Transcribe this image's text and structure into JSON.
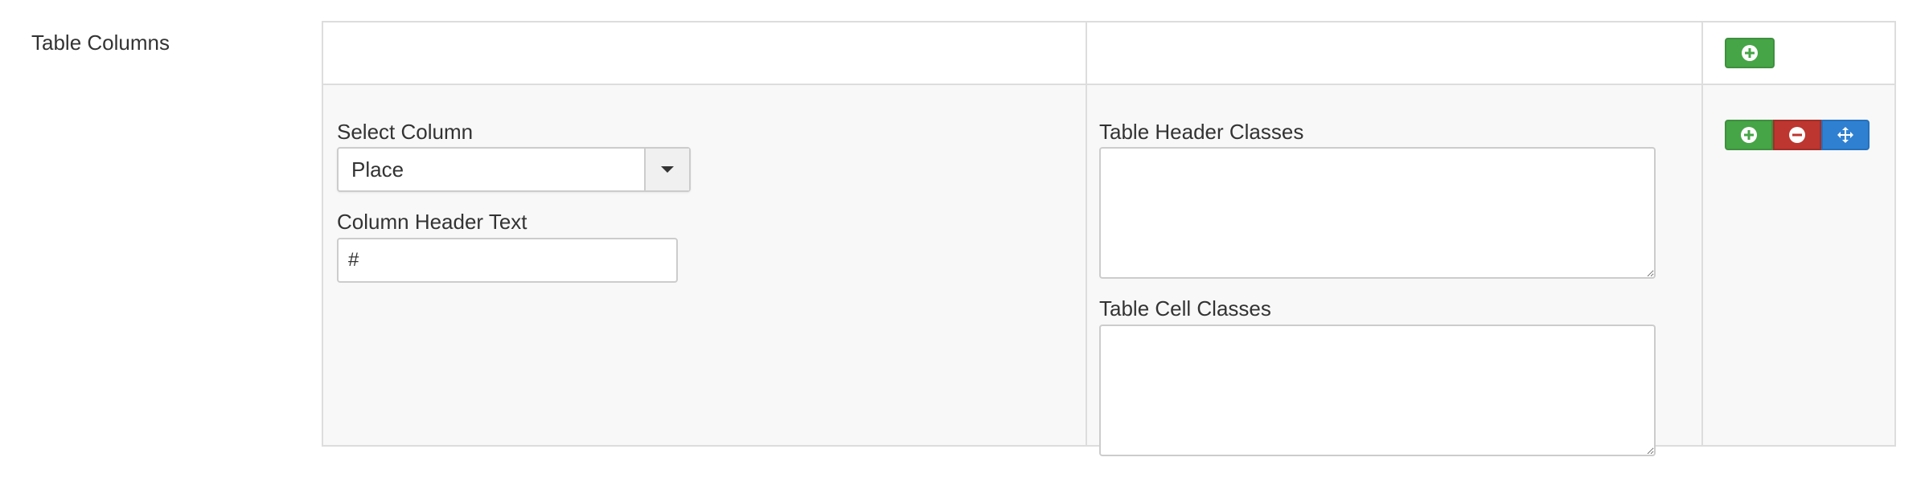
{
  "field": {
    "label": "Table Columns"
  },
  "row": {
    "select_column_label": "Select Column",
    "select_column_value": "Place",
    "column_header_text_label": "Column Header Text",
    "column_header_text_value": "#",
    "table_header_classes_label": "Table Header Classes",
    "table_header_classes_value": "",
    "table_cell_classes_label": "Table Cell Classes",
    "table_cell_classes_value": ""
  },
  "icons": {
    "add": "plus-circle-icon",
    "remove": "minus-circle-icon",
    "move": "move-arrows-icon"
  },
  "colors": {
    "add_button": "#46a546",
    "remove_button": "#bd362f",
    "move_button": "#2f80d1",
    "row_background": "#f8f8f8",
    "border": "#dddddd"
  }
}
